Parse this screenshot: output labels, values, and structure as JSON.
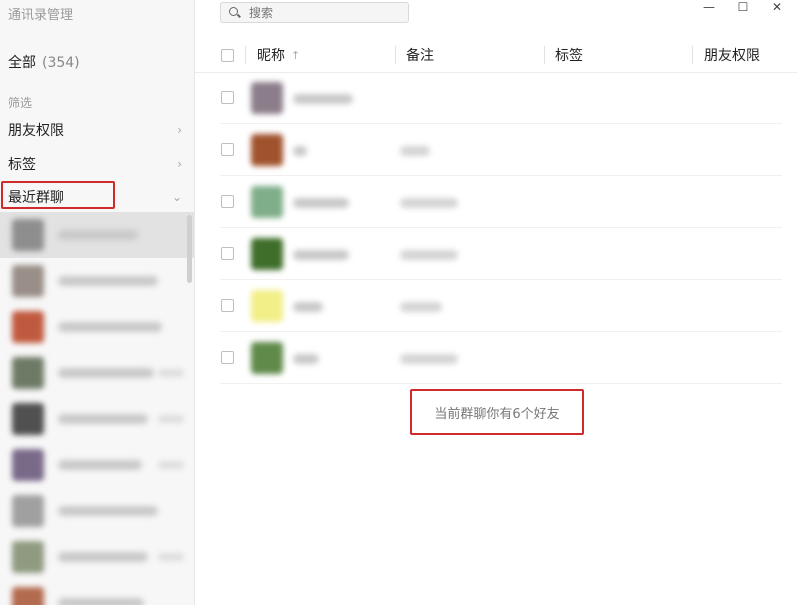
{
  "app": {
    "title": "通讯录管理"
  },
  "sidebar": {
    "all_label": "全部",
    "all_count": "(354)",
    "filter_label": "筛选",
    "items": [
      {
        "label": "朋友权限",
        "chevron": "›"
      },
      {
        "label": "标签",
        "chevron": "›"
      },
      {
        "label": "最近群聊",
        "chevron": "⌄"
      }
    ],
    "groups": [
      {
        "avatar_color": "#8e8e8e",
        "active": true
      },
      {
        "avatar_color": "#9a8f88"
      },
      {
        "avatar_color": "#c05a3e"
      },
      {
        "avatar_color": "#6f7a66"
      },
      {
        "avatar_color": "#505050"
      },
      {
        "avatar_color": "#7a6a8a"
      },
      {
        "avatar_color": "#a0a0a0"
      },
      {
        "avatar_color": "#8f9a80"
      },
      {
        "avatar_color": "#b36b4f"
      }
    ]
  },
  "search": {
    "placeholder": "搜索",
    "icon": "search-icon"
  },
  "window_controls": {
    "minimize": "—",
    "maximize": "☐",
    "close": "✕"
  },
  "table": {
    "columns": [
      {
        "label": "昵称",
        "sort": "↑"
      },
      {
        "label": "备注"
      },
      {
        "label": "标签"
      },
      {
        "label": "朋友权限"
      }
    ],
    "rows": [
      {
        "avatar_color": "#8c7d8a"
      },
      {
        "avatar_color": "#a0522d"
      },
      {
        "avatar_color": "#7fae8a"
      },
      {
        "avatar_color": "#3f6e2a"
      },
      {
        "avatar_color": "#f2ef88"
      },
      {
        "avatar_color": "#5f8a4a"
      }
    ]
  },
  "summary_text": "当前群聊你有6个好友",
  "colors": {
    "highlight": "#d02b2b",
    "sidebar_bg": "#f7f7f7",
    "active_group_bg": "#e2e2e2"
  }
}
